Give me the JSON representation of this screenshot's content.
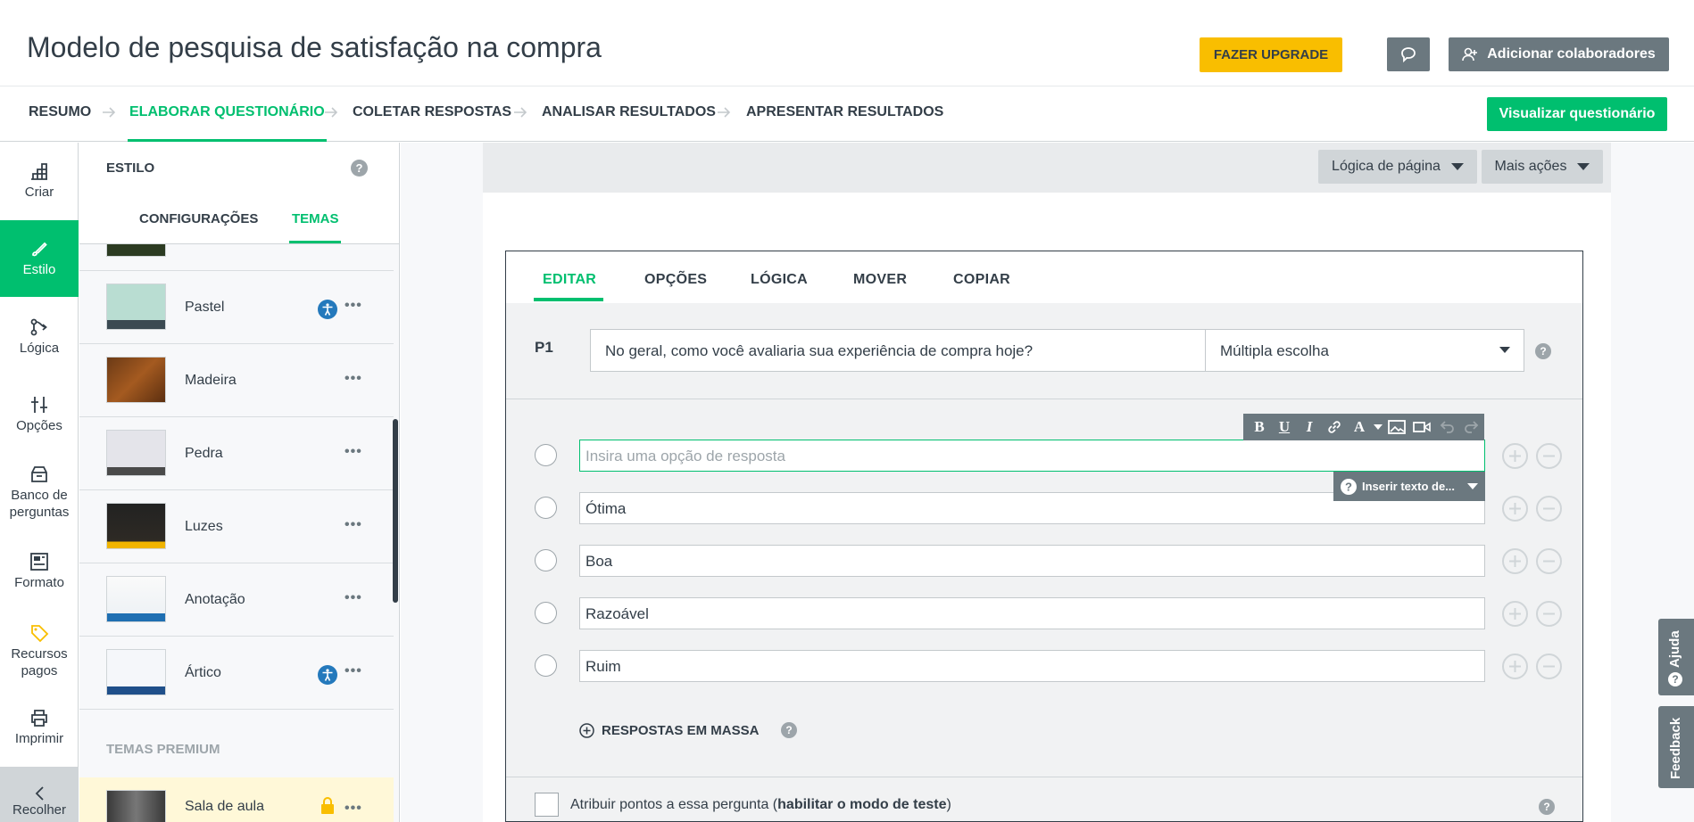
{
  "header": {
    "title": "Modelo de pesquisa de satisfação na compra",
    "upgrade_label": "FAZER UPGRADE",
    "collab_label": "Adicionar colaboradores",
    "preview_label": "Visualizar questionário"
  },
  "steps": [
    "RESUMO",
    "ELABORAR QUESTIONÁRIO",
    "COLETAR RESPOSTAS",
    "ANALISAR RESULTADOS",
    "APRESENTAR RESULTADOS"
  ],
  "leftnav": {
    "criar": "Criar",
    "estilo": "Estilo",
    "logica": "Lógica",
    "opcoes": "Opções",
    "banco1": "Banco de",
    "banco2": "perguntas",
    "formato": "Formato",
    "recursos1": "Recursos",
    "recursos2": "pagos",
    "imprimir": "Imprimir",
    "recolher": "Recolher"
  },
  "panel": {
    "title": "ESTILO",
    "help": "?",
    "tabs": [
      "CONFIGURAÇÕES",
      "TEMAS"
    ],
    "themes": [
      "Pastel",
      "Madeira",
      "Pedra",
      "Luzes",
      "Anotação",
      "Ártico"
    ],
    "premium_heading": "TEMAS PREMIUM",
    "premium_theme": "Sala de aula",
    "more": "•••"
  },
  "canvas": {
    "page_logic": "Lógica de página",
    "more_actions": "Mais ações"
  },
  "question": {
    "tabs": [
      "EDITAR",
      "OPÇÕES",
      "LÓGICA",
      "MOVER",
      "COPIAR"
    ],
    "number": "P1",
    "text": "No geral, como você avaliaria sua experiência de compra hoje?",
    "type": "Múltipla escolha",
    "new_answer_placeholder": "Insira uma opção de resposta",
    "answers": [
      "Ótima",
      "Boa",
      "Razoável",
      "Ruim"
    ],
    "insert_label": "Inserir texto de...",
    "bulk_label": "RESPOSTAS EM MASSA",
    "points_prefix": "Atribuir pontos a essa pergunta (",
    "points_bold": "habilitar o modo de teste",
    "points_suffix": ")"
  },
  "sidetabs": {
    "help": "Ajuda",
    "feedback": "Feedback"
  },
  "colors": {
    "accent": "#00bf6f",
    "upgrade": "#f9be00",
    "gray_button": "#6b787f",
    "text": "#333e48"
  }
}
